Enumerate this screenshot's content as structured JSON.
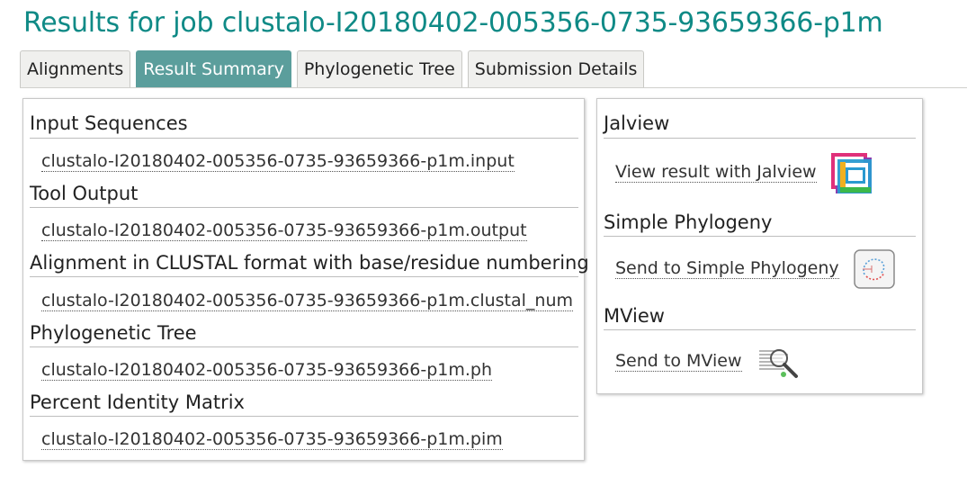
{
  "page": {
    "title": "Results for job clustalo-I20180402-005356-0735-93659366-p1m"
  },
  "tabs": [
    {
      "label": "Alignments",
      "active": false
    },
    {
      "label": "Result Summary",
      "active": true
    },
    {
      "label": "Phylogenetic Tree",
      "active": false
    },
    {
      "label": "Submission Details",
      "active": false
    }
  ],
  "results": [
    {
      "heading": "Input Sequences",
      "file": "clustalo-I20180402-005356-0735-93659366-p1m.input"
    },
    {
      "heading": "Tool Output",
      "file": "clustalo-I20180402-005356-0735-93659366-p1m.output"
    },
    {
      "heading": "Alignment in CLUSTAL format with base/residue numbering",
      "file": "clustalo-I20180402-005356-0735-93659366-p1m.clustal_num"
    },
    {
      "heading": "Phylogenetic Tree",
      "file": "clustalo-I20180402-005356-0735-93659366-p1m.ph"
    },
    {
      "heading": "Percent Identity Matrix",
      "file": "clustalo-I20180402-005356-0735-93659366-p1m.pim"
    }
  ],
  "services": [
    {
      "heading": "Jalview",
      "link": "View result with Jalview",
      "icon": "jalview-icon"
    },
    {
      "heading": "Simple Phylogeny",
      "link": "Send to Simple Phylogeny",
      "icon": "simple-phylogeny-icon"
    },
    {
      "heading": "MView",
      "link": "Send to MView",
      "icon": "mview-icon"
    }
  ],
  "colors": {
    "title": "#0f8a86",
    "active_tab": "#5b9e9c"
  }
}
